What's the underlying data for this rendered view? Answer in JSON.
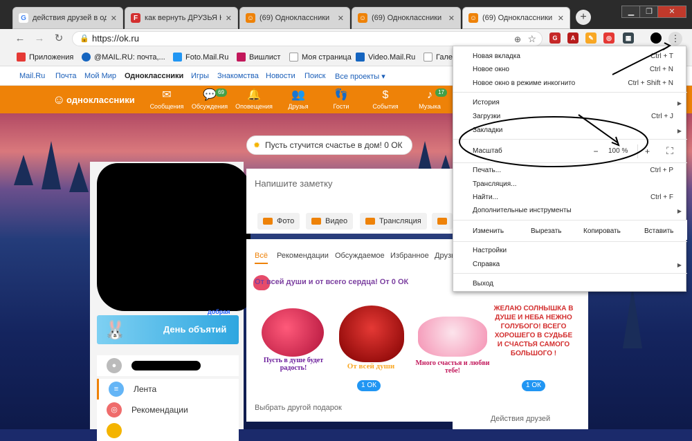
{
  "tabs": [
    {
      "title": "действия друзей в однокласс",
      "fav": "G",
      "color": "#ffffff",
      "fg": "#4285f4"
    },
    {
      "title": "как вернуть ДРУЗЬЯ Н",
      "fav": "F",
      "color": "#d32f2f",
      "fg": "#fff"
    },
    {
      "title": "(69) Одноклассники",
      "fav": "ok",
      "color": "#ee8208",
      "fg": "#fff"
    },
    {
      "title": "(69) Одноклассники",
      "fav": "ok",
      "color": "#ee8208",
      "fg": "#fff"
    },
    {
      "title": "(69) Одноклассники",
      "fav": "ok",
      "color": "#ee8208",
      "fg": "#fff"
    }
  ],
  "toolbar": {
    "url": "https://ok.ru",
    "back": "←",
    "forward": "→",
    "reload": "↻"
  },
  "bookmarks": [
    {
      "label": "Приложения",
      "color": "#e53935"
    },
    {
      "label": "@MAIL.RU: почта,...",
      "color": "#1565c0"
    },
    {
      "label": "Foto.Mail.Ru",
      "color": "#2196f3"
    },
    {
      "label": "Вишлист",
      "color": "#c2185b"
    },
    {
      "label": "Моя страница",
      "color": "#bbbbbb"
    },
    {
      "label": "Video.Mail.Ru",
      "color": "#1565c0"
    },
    {
      "label": "Гале",
      "color": "#bbbbbb"
    }
  ],
  "mailbar": [
    "Mail.Ru",
    "Почта",
    "Мой Мир",
    "Одноклассники",
    "Игры",
    "Знакомства",
    "Новости",
    "Поиск",
    "Все проекты ▾"
  ],
  "ok": {
    "logo": "одноклассники",
    "nav": [
      {
        "label": "Сообщения",
        "glyph": "✉",
        "badge": ""
      },
      {
        "label": "Обсуждения",
        "glyph": "💬",
        "badge": "69"
      },
      {
        "label": "Оповещения",
        "glyph": "🔔",
        "badge": ""
      },
      {
        "label": "Друзья",
        "glyph": "👥",
        "badge": ""
      },
      {
        "label": "Гости",
        "glyph": "👣",
        "badge": ""
      },
      {
        "label": "События",
        "glyph": "$",
        "badge": ""
      },
      {
        "label": "Музыка",
        "glyph": "♪",
        "badge": "17"
      }
    ],
    "mood": "Пусть стучится счастье в дом! 0 ОК",
    "note_placeholder": "Напишите заметку",
    "post_buttons": [
      "Фото",
      "Видео",
      "Трансляция"
    ],
    "feed_tabs": [
      "Всё",
      "Рекомендации",
      "Обсуждаемое",
      "Избранное",
      "Друзь"
    ],
    "gift_line": "От всей души и от всего сердца! От 0 ОК",
    "gift_captions": [
      "Пусть в душе будет радость!",
      "От всей души",
      "Много счастья и любви тебе!",
      "ЖЕЛАЮ СОЛНЫШКА В ДУШЕ И НЕБА НЕЖНО ГОЛУБОГО! ВСЕГО ХОРОШЕГО В СУДЬБЕ И СЧАСТЬЯ САМОГО БОЛЬШОГО !"
    ],
    "gift_price": "1 ОК",
    "choose_gift": "Выбрать другой подарок",
    "friends_actions": "Действия друзей",
    "day_ads": "День объятий",
    "day_ads_tag": "добрая",
    "left_menu": [
      "Лента",
      "Рекомендации"
    ]
  },
  "menu": {
    "items": [
      {
        "label": "Новая вкладка",
        "shortcut": "Ctrl + T"
      },
      {
        "label": "Новое окно",
        "shortcut": "Ctrl + N"
      },
      {
        "label": "Новое окно в режиме инкогнито",
        "shortcut": "Ctrl + Shift + N"
      },
      {
        "label": "История",
        "shortcut": ""
      },
      {
        "label": "Загрузки",
        "shortcut": "Ctrl + J"
      },
      {
        "label": "Закладки",
        "shortcut": ""
      },
      {
        "label": "Масштаб",
        "shortcut": ""
      },
      {
        "label": "Печать...",
        "shortcut": "Ctrl + P"
      },
      {
        "label": "Трансляция...",
        "shortcut": ""
      },
      {
        "label": "Найти...",
        "shortcut": "Ctrl + F"
      },
      {
        "label": "Дополнительные инструменты",
        "shortcut": ""
      },
      {
        "label": "Настройки",
        "shortcut": ""
      },
      {
        "label": "Справка",
        "shortcut": ""
      },
      {
        "label": "Выход",
        "shortcut": ""
      }
    ],
    "zoom": {
      "minus": "−",
      "value": "100 %",
      "plus": "+"
    },
    "edit": [
      "Изменить",
      "Вырезать",
      "Копировать",
      "Вставить"
    ]
  }
}
